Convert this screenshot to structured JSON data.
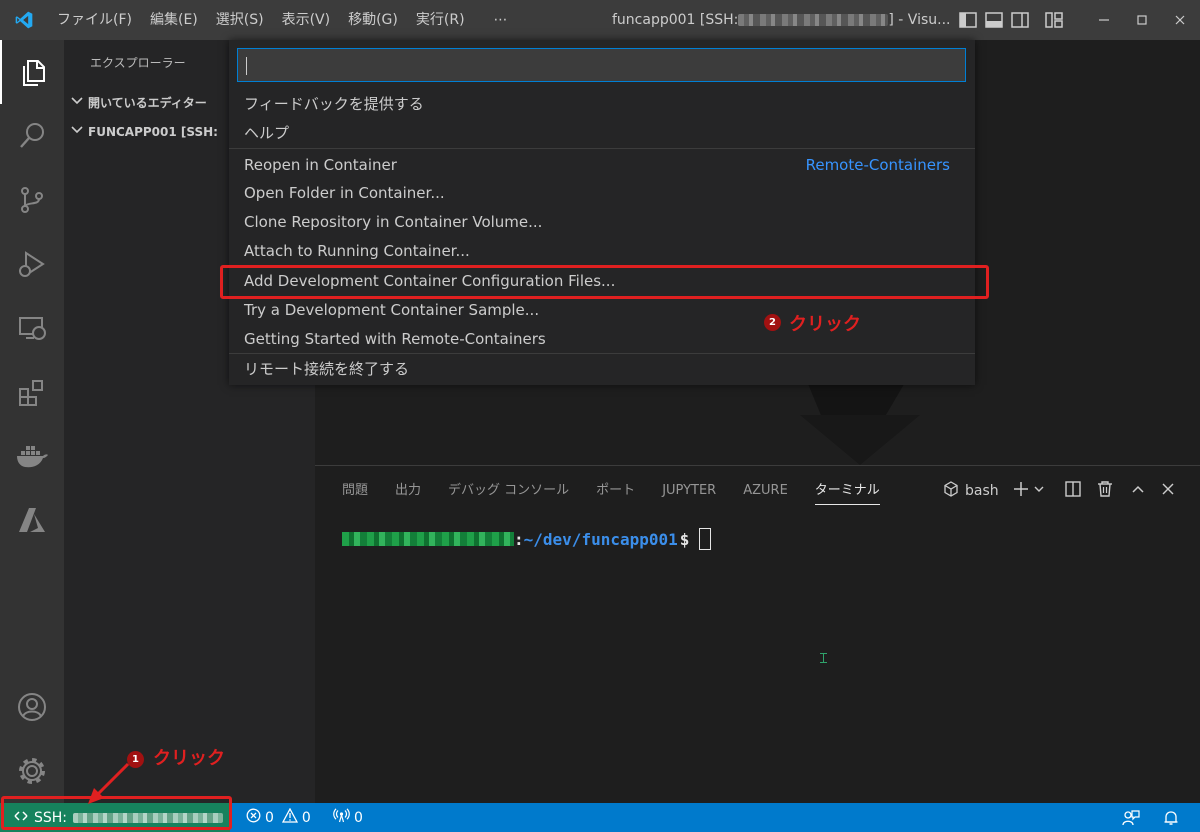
{
  "titlebar": {
    "menu": [
      "ファイル(F)",
      "編集(E)",
      "選択(S)",
      "表示(V)",
      "移動(G)",
      "実行(R)",
      "⋯"
    ],
    "title_prefix": "funcapp001 [SSH:",
    "title_suffix": "] - Visu..."
  },
  "sidebar": {
    "title": "エクスプローラー",
    "open_editors": "開いているエディター",
    "folder": "FUNCAPP001 [SSH:"
  },
  "quickpick": {
    "input_value": "",
    "items": [
      "フィードバックを提供する",
      "ヘルプ",
      "Reopen in Container",
      "Open Folder in Container...",
      "Clone Repository in Container Volume...",
      "Attach to Running Container...",
      "Add Development Container Configuration Files...",
      "Try a Development Container Sample...",
      "Getting Started with Remote-Containers",
      "リモート接続を終了する"
    ],
    "group_label": "Remote-Containers"
  },
  "panel": {
    "tabs": [
      "問題",
      "出力",
      "デバッグ コンソール",
      "ポート",
      "JUPYTER",
      "AZURE",
      "ターミナル"
    ],
    "active_tab": "ターミナル",
    "shell": "bash",
    "terminal": {
      "separator": ":",
      "path": "~/dev/funcapp001",
      "prompt": "$"
    }
  },
  "statusbar": {
    "remote_label": "SSH:",
    "errors": "0",
    "warnings": "0",
    "ports": "0"
  },
  "annotations": {
    "step1_number": "1",
    "step1_text": "クリック",
    "step2_number": "2",
    "step2_text": "クリック"
  },
  "colors": {
    "accent": "#007acc",
    "remote": "#16825d",
    "annotation": "#e02020",
    "link": "#3794ff"
  }
}
